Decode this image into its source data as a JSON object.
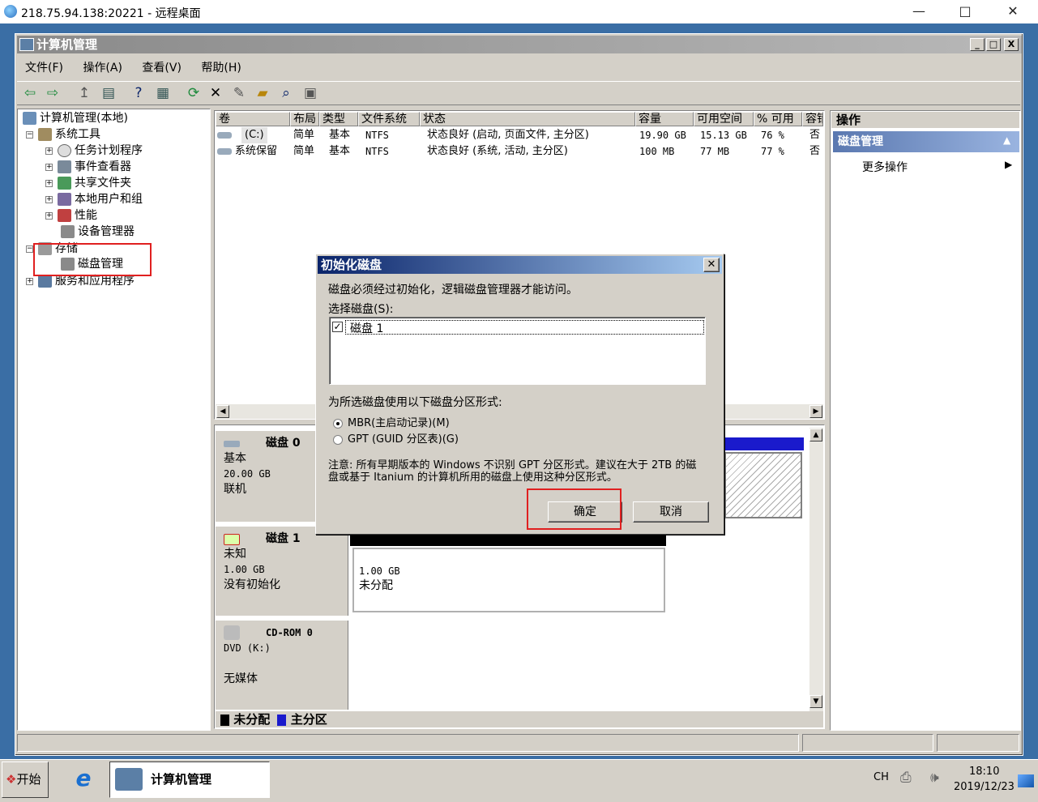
{
  "remote_desktop": {
    "title": "218.75.94.138:20221 - 远程桌面",
    "min": "—",
    "max": "□",
    "close": "✕"
  },
  "window": {
    "title": "计算机管理",
    "min": "_",
    "max": "□",
    "close": "X"
  },
  "menu": [
    "文件(F)",
    "操作(A)",
    "查看(V)",
    "帮助(H)"
  ],
  "tree": {
    "root": "计算机管理(本地)",
    "system_tools": "系统工具",
    "task_scheduler": "任务计划程序",
    "event_viewer": "事件查看器",
    "shared_folders": "共享文件夹",
    "local_users": "本地用户和组",
    "performance": "性能",
    "device_manager": "设备管理器",
    "storage": "存储",
    "disk_management": "磁盘管理",
    "services": "服务和应用程序"
  },
  "volume_table": {
    "headers": [
      "卷",
      "布局",
      "类型",
      "文件系统",
      "状态",
      "容量",
      "可用空间",
      "% 可用",
      "容错"
    ],
    "rows": [
      [
        "(C:)",
        "简单",
        "基本",
        "NTFS",
        "状态良好 (启动, 页面文件, 主分区)",
        "19.90 GB",
        "15.13 GB",
        "76 %",
        "否"
      ],
      [
        "系统保留",
        "简单",
        "基本",
        "NTFS",
        "状态良好 (系统, 活动, 主分区)",
        "100 MB",
        "77 MB",
        "77 %",
        "否"
      ]
    ]
  },
  "disks": {
    "disk0": {
      "name": "磁盘 0",
      "type": "基本",
      "size": "20.00 GB",
      "status": "联机"
    },
    "disk1": {
      "name": "磁盘 1",
      "type": "未知",
      "size": "1.00 GB",
      "status": "没有初始化",
      "part_size": "1.00 GB",
      "part_status": "未分配"
    },
    "cdrom": {
      "name": "CD-ROM 0",
      "type": "DVD (K:)",
      "status": "无媒体"
    }
  },
  "legend": {
    "unallocated": "未分配",
    "primary": "主分区"
  },
  "actions": {
    "header": "操作",
    "section": "磁盘管理",
    "more": "更多操作"
  },
  "dialog": {
    "title": "初始化磁盘",
    "message": "磁盘必须经过初始化，逻辑磁盘管理器才能访问。",
    "select_label": "选择磁盘(S):",
    "disk_item": "磁盘 1",
    "style_label": "为所选磁盘使用以下磁盘分区形式:",
    "mbr": "MBR(主启动记录)(M)",
    "gpt": "GPT (GUID 分区表)(G)",
    "note": "注意: 所有早期版本的 Windows 不识别 GPT 分区形式。建议在大于 2TB 的磁盘或基于 Itanium 的计算机所用的磁盘上使用这种分区形式。",
    "ok": "确定",
    "cancel": "取消"
  },
  "taskbar": {
    "start": "开始",
    "task": "计算机管理",
    "lang": "CH",
    "time": "18:10",
    "date": "2019/12/23"
  },
  "colors": {
    "unallocated": "#000000",
    "primary": "#1a1acc",
    "highlight": "#e02020"
  }
}
